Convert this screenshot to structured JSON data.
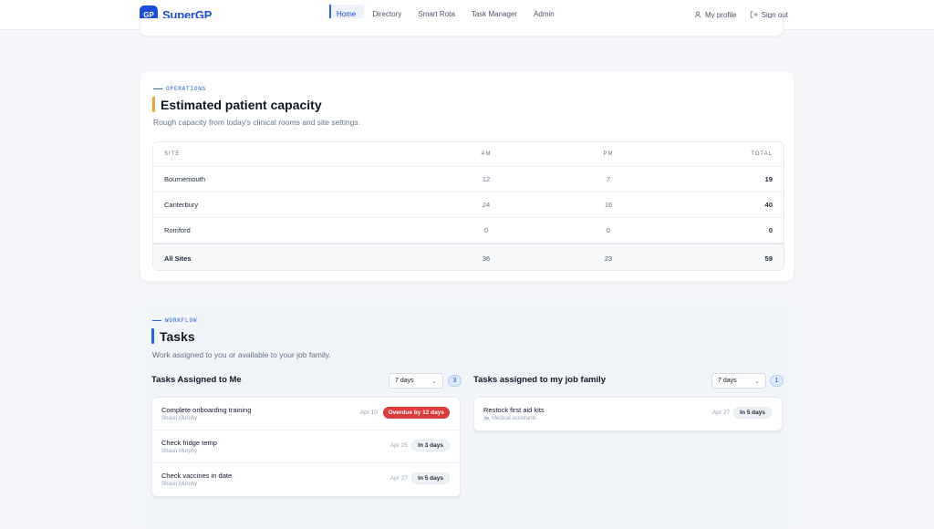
{
  "app": {
    "logo_mark": "GP",
    "name": "SuperGP",
    "brand_color": "#1d4ed8"
  },
  "nav": {
    "links": [
      {
        "label": "Home",
        "active": true
      },
      {
        "label": "Directory"
      },
      {
        "label": "Smart Rota"
      },
      {
        "label": "Task Manager"
      },
      {
        "label": "Admin"
      }
    ],
    "profile_label": "My profile",
    "signout_label": "Sign out",
    "profile_icon": "user-icon",
    "signout_icon": "sign-out-icon"
  },
  "capacity": {
    "eyebrow": "OPERATIONS",
    "title": "Estimated patient capacity",
    "subtitle": "Rough capacity from today's clinical rooms and site settings.",
    "accent_color": "#f0a23a",
    "headers": {
      "site": "SITE",
      "am": "AM",
      "pm": "PM",
      "total": "TOTAL"
    },
    "rows": [
      {
        "site": "Bournemouth",
        "am": "12",
        "pm": "7",
        "total": "19"
      },
      {
        "site": "Canterbury",
        "am": "24",
        "pm": "16",
        "total": "40"
      },
      {
        "site": "Romford",
        "am": "0",
        "pm": "0",
        "total": "0"
      }
    ],
    "total_row": {
      "site": "All Sites",
      "am": "36",
      "pm": "23",
      "total": "59"
    }
  },
  "tasks": {
    "eyebrow": "WORKFLOW",
    "title": "Tasks",
    "subtitle": "Work assigned to you or available to your job family.",
    "accent_color": "#2563eb",
    "assigned": {
      "title": "Tasks Assigned to Me",
      "range": "7 days",
      "count": "3",
      "items": [
        {
          "title": "Complete onboarding training",
          "meta": "Shaun Murphy",
          "date": "Apr 10",
          "status": "Overdue by 12 days",
          "status_color": "#dc3b3b"
        },
        {
          "title": "Check fridge temp",
          "meta": "Shaun Murphy",
          "date": "Apr 25",
          "status": "In 3 days"
        },
        {
          "title": "Check vaccines in date",
          "meta": "Shaun Murphy",
          "date": "Apr 27",
          "status": "In 5 days"
        }
      ]
    },
    "family": {
      "title": "Tasks assigned to my job family",
      "range": "7 days",
      "count": "1",
      "items": [
        {
          "title": "Restock first aid kits",
          "meta": "Medical assistants",
          "meta_icon": "group-icon",
          "date": "Apr 27",
          "status": "In 5 days"
        }
      ]
    }
  }
}
